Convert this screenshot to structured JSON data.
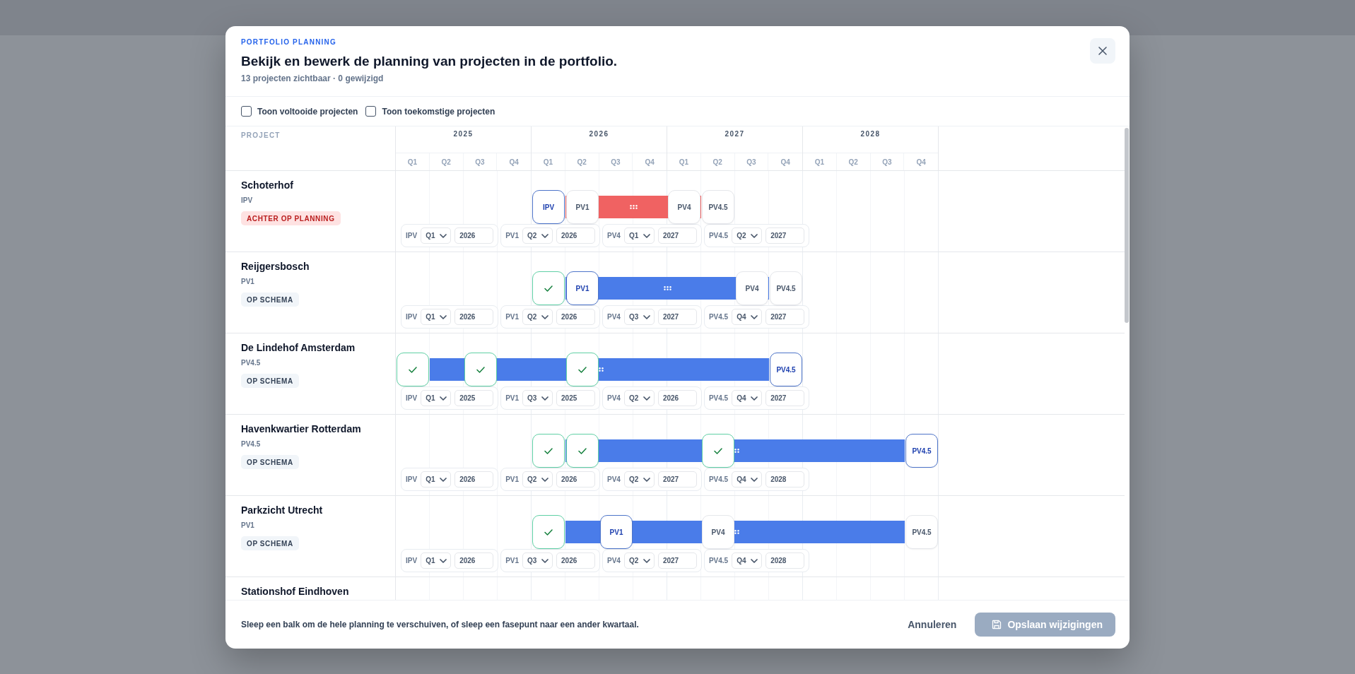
{
  "dialog": {
    "eyebrow": "PORTFOLIO PLANNING",
    "title": "Bekijk en bewerk de planning van projecten in de portfolio.",
    "subtitle": "13 projecten zichtbaar · 0 gewijzigd"
  },
  "filters": [
    {
      "label": "Toon voltooide projecten",
      "checked": false
    },
    {
      "label": "Toon toekomstige projecten",
      "checked": false
    }
  ],
  "timeline": {
    "project_header": "PROJECT",
    "years": [
      {
        "label": "2025",
        "quarters": [
          "Q1",
          "Q2",
          "Q3",
          "Q4"
        ]
      },
      {
        "label": "2026",
        "quarters": [
          "Q1",
          "Q2",
          "Q3",
          "Q4"
        ]
      },
      {
        "label": "2027",
        "quarters": [
          "Q1",
          "Q2",
          "Q3",
          "Q4"
        ]
      },
      {
        "label": "2028",
        "quarters": [
          "Q1",
          "Q2",
          "Q3",
          "Q4"
        ]
      }
    ]
  },
  "projects": [
    {
      "name": "Schoterhof",
      "phase": "IPV",
      "status": {
        "label": "ACHTER OP PLANNING",
        "kind": "behind"
      },
      "phases": [
        {
          "code": "IPV",
          "quarter": "Q1",
          "year": "2026",
          "marker": {
            "label": "IPV",
            "done": false,
            "current": true
          }
        },
        {
          "code": "PV1",
          "quarter": "Q2",
          "year": "2026",
          "marker": {
            "label": "PV1",
            "done": false,
            "current": false
          }
        },
        {
          "code": "PV4",
          "quarter": "Q1",
          "year": "2027",
          "marker": {
            "label": "PV4",
            "done": false,
            "current": false
          }
        },
        {
          "code": "PV4.5",
          "quarter": "Q2",
          "year": "2027",
          "marker": {
            "label": "PV4.5",
            "done": false,
            "current": false
          }
        }
      ]
    },
    {
      "name": "Reijgersbosch",
      "phase": "PV1",
      "status": {
        "label": "OP SCHEMA",
        "kind": "on_track"
      },
      "phases": [
        {
          "code": "IPV",
          "quarter": "Q1",
          "year": "2026",
          "marker": {
            "done": true,
            "current": false
          }
        },
        {
          "code": "PV1",
          "quarter": "Q2",
          "year": "2026",
          "marker": {
            "label": "PV1",
            "done": false,
            "current": true
          }
        },
        {
          "code": "PV4",
          "quarter": "Q3",
          "year": "2027",
          "marker": {
            "label": "PV4",
            "done": false,
            "current": false
          }
        },
        {
          "code": "PV4.5",
          "quarter": "Q4",
          "year": "2027",
          "marker": {
            "label": "PV4.5",
            "done": false,
            "current": false
          }
        }
      ]
    },
    {
      "name": "De Lindehof Amsterdam",
      "phase": "PV4.5",
      "status": {
        "label": "OP SCHEMA",
        "kind": "on_track"
      },
      "phases": [
        {
          "code": "IPV",
          "quarter": "Q1",
          "year": "2025",
          "marker": {
            "done": true,
            "current": false
          }
        },
        {
          "code": "PV1",
          "quarter": "Q3",
          "year": "2025",
          "marker": {
            "done": true,
            "current": false
          }
        },
        {
          "code": "PV4",
          "quarter": "Q2",
          "year": "2026",
          "marker": {
            "done": true,
            "current": false
          }
        },
        {
          "code": "PV4.5",
          "quarter": "Q4",
          "year": "2027",
          "marker": {
            "label": "PV4.5",
            "done": false,
            "current": true
          }
        }
      ]
    },
    {
      "name": "Havenkwartier Rotterdam",
      "phase": "PV4.5",
      "status": {
        "label": "OP SCHEMA",
        "kind": "on_track"
      },
      "phases": [
        {
          "code": "IPV",
          "quarter": "Q1",
          "year": "2026",
          "marker": {
            "done": true,
            "current": false
          }
        },
        {
          "code": "PV1",
          "quarter": "Q2",
          "year": "2026",
          "marker": {
            "done": true,
            "current": false
          }
        },
        {
          "code": "PV4",
          "quarter": "Q2",
          "year": "2027",
          "marker": {
            "done": true,
            "current": false
          }
        },
        {
          "code": "PV4.5",
          "quarter": "Q4",
          "year": "2028",
          "marker": {
            "label": "PV4.5",
            "done": false,
            "current": true
          }
        }
      ]
    },
    {
      "name": "Parkzicht Utrecht",
      "phase": "PV1",
      "status": {
        "label": "OP SCHEMA",
        "kind": "on_track"
      },
      "phases": [
        {
          "code": "IPV",
          "quarter": "Q1",
          "year": "2026",
          "marker": {
            "done": true,
            "current": false
          }
        },
        {
          "code": "PV1",
          "quarter": "Q3",
          "year": "2026",
          "marker": {
            "label": "PV1",
            "done": false,
            "current": true
          }
        },
        {
          "code": "PV4",
          "quarter": "Q2",
          "year": "2027",
          "marker": {
            "label": "PV4",
            "done": false,
            "current": false
          }
        },
        {
          "code": "PV4.5",
          "quarter": "Q4",
          "year": "2028",
          "marker": {
            "label": "PV4.5",
            "done": false,
            "current": false
          }
        }
      ]
    },
    {
      "name": "Stationshof Eindhoven"
    }
  ],
  "footer": {
    "hint": "Sleep een balk om de hele planning te verschuiven, of sleep een fasepunt naar een ander kwartaal.",
    "cancel": "Annuleren",
    "save": {
      "label": "Opslaan wijzigingen",
      "disabled": true
    }
  }
}
